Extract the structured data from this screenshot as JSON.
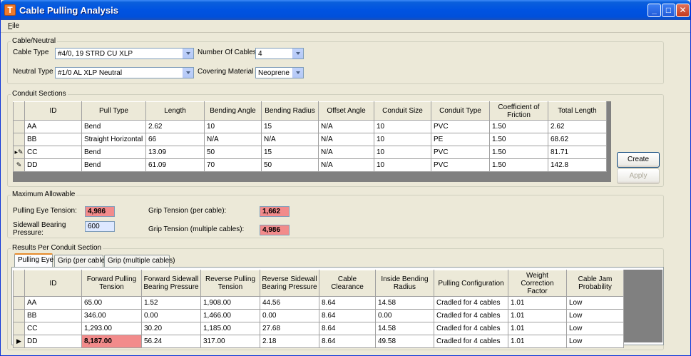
{
  "window": {
    "title": "Cable Pulling Analysis",
    "icon_letter": "T"
  },
  "menu": {
    "file": "File"
  },
  "cable_neutral": {
    "title": "Cable/Neutral",
    "cable_type_label": "Cable Type",
    "cable_type_value": "#4/0, 19 STRD CU XLP",
    "neutral_type_label": "Neutral Type",
    "neutral_type_value": "#1/0 AL XLP Neutral",
    "number_of_cables_label": "Number Of Cables",
    "number_of_cables_value": "4",
    "covering_material_label": "Covering Material",
    "covering_material_value": "Neoprene"
  },
  "conduit_sections": {
    "title": "Conduit Sections",
    "headers": [
      "ID",
      "Pull Type",
      "Length",
      "Bending Angle",
      "Bending Radius",
      "Offset Angle",
      "Conduit Size",
      "Conduit Type",
      "Coefficient of Friction",
      "Total Length"
    ],
    "rows": [
      [
        "AA",
        "Bend",
        "2.62",
        "10",
        "15",
        "N/A",
        "10",
        "PVC",
        "1.50",
        "2.62"
      ],
      [
        "BB",
        "Straight Horizontal",
        "66",
        "N/A",
        "N/A",
        "N/A",
        "10",
        "PE",
        "1.50",
        "68.62"
      ],
      [
        "CC",
        "Bend",
        "13.09",
        "50",
        "15",
        "N/A",
        "10",
        "PVC",
        "1.50",
        "81.71"
      ],
      [
        "DD",
        "Bend",
        "61.09",
        "70",
        "50",
        "N/A",
        "10",
        "PVC",
        "1.50",
        "142.8"
      ]
    ],
    "row_markers": [
      "",
      "",
      "▸✎",
      "✎"
    ],
    "create_label": "Create",
    "apply_label": "Apply"
  },
  "maximum_allowable": {
    "title": "Maximum Allowable",
    "pulling_eye_label": "Pulling Eye Tension:",
    "pulling_eye_value": "4,986",
    "sidewall_label_1": "Sidewall Bearing",
    "sidewall_label_2": "Pressure:",
    "sidewall_value": "600",
    "grip_per_cable_label": "Grip Tension (per cable):",
    "grip_per_cable_value": "1,662",
    "grip_multiple_label": "Grip Tension (multiple cables):",
    "grip_multiple_value": "4,986"
  },
  "results": {
    "title": "Results Per Conduit Section",
    "tabs": [
      "Pulling Eye",
      "Grip (per cable)",
      "Grip (multiple cables)"
    ],
    "active_tab": 0,
    "headers": [
      "ID",
      "Forward Pulling Tension",
      "Forward Sidewall Bearing Pressure",
      "Reverse Pulling Tension",
      "Reverse Sidewall Bearing Pressure",
      "Cable Clearance",
      "Inside Bending Radius",
      "Pulling Configuration",
      "Weight Correction Factor",
      "Cable Jam Probability"
    ],
    "rows": [
      [
        "AA",
        "65.00",
        "1.52",
        "1,908.00",
        "44.56",
        "8.64",
        "14.58",
        "Cradled for 4 cables",
        "1.01",
        "Low"
      ],
      [
        "BB",
        "346.00",
        "0.00",
        "1,466.00",
        "0.00",
        "8.64",
        "0.00",
        "Cradled for 4 cables",
        "1.01",
        "Low"
      ],
      [
        "CC",
        "1,293.00",
        "30.20",
        "1,185.00",
        "27.68",
        "8.64",
        "14.58",
        "Cradled for 4 cables",
        "1.01",
        "Low"
      ],
      [
        "DD",
        "8,187.00",
        "56.24",
        "317.00",
        "2.18",
        "8.64",
        "49.58",
        "Cradled for 4 cables",
        "1.01",
        "Low"
      ]
    ],
    "row_markers": [
      "",
      "",
      "",
      "▶"
    ],
    "highlight_color": "#f28b8b"
  }
}
